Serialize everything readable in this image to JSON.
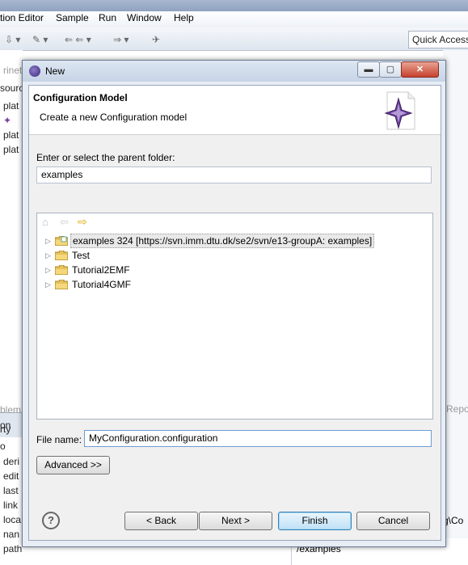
{
  "background": {
    "menu": [
      "tion Editor",
      "Sample",
      "Run",
      "Window",
      "Help"
    ],
    "quick_access": "Quick Access",
    "left_fragments": [
      "rinet.",
      "sourc",
      "plat",
      "plat",
      "plat",
      "on",
      "blem",
      "rty",
      "o",
      "deri",
      "edit",
      "last",
      "link",
      "loca",
      "nan",
      "path"
    ],
    "right_fragments": [
      "Repo",
      "g\\Co",
      "/examples"
    ]
  },
  "dialog": {
    "title": "New",
    "window_buttons": {
      "minimize": "▬",
      "maximize": "▢",
      "close": "✕"
    },
    "header_title": "Configuration Model",
    "header_description": "Create a new Configuration model",
    "parent_folder_label": "Enter or select the parent folder:",
    "parent_folder_value": "examples",
    "tree_items": [
      {
        "label": "examples 324 [https://svn.imm.dtu.dk/se2/svn/e13-groupA: examples]",
        "selected": true
      },
      {
        "label": "Test"
      },
      {
        "label": "Tutorial2EMF"
      },
      {
        "label": "Tutorial4GMF"
      }
    ],
    "file_name_label": "File name:",
    "file_name_value": "MyConfiguration.configuration",
    "advanced_label": "Advanced >>",
    "buttons": {
      "help": "?",
      "back": "< Back",
      "next": "Next >",
      "finish": "Finish",
      "cancel": "Cancel"
    }
  },
  "colors": {
    "accent": "#3c7fb1",
    "close_button": "#c6412d",
    "wizard_icon": "#6a3f9a"
  }
}
